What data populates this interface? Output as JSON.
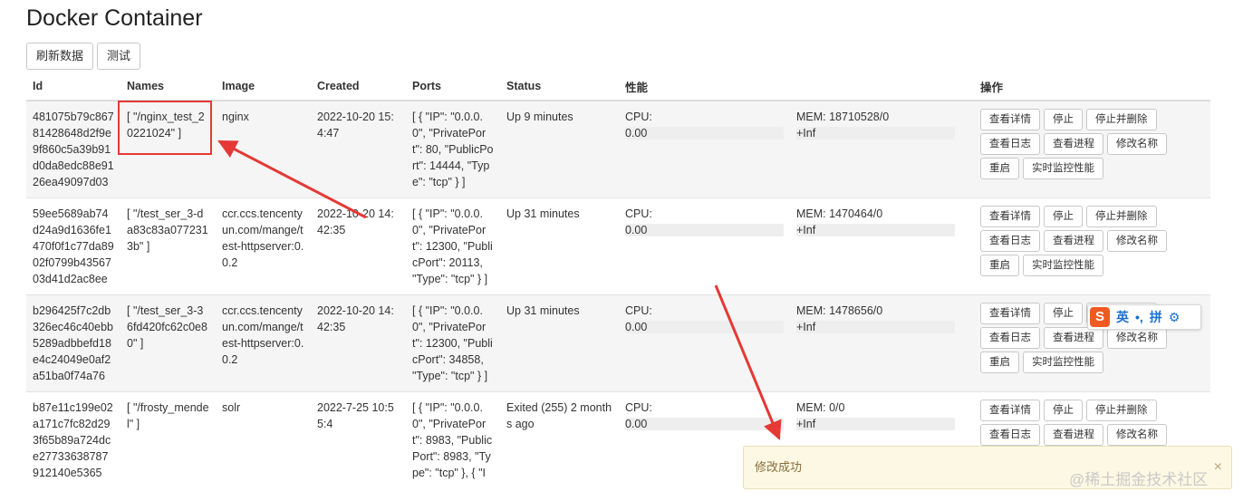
{
  "page": {
    "title": "Docker Container"
  },
  "toolbar": {
    "refresh_label": "刷新数据",
    "test_label": "测试"
  },
  "table": {
    "headers": {
      "id": "Id",
      "names": "Names",
      "image": "Image",
      "created": "Created",
      "ports": "Ports",
      "status": "Status",
      "perf": "性能",
      "ops": "操作"
    },
    "perf_labels": {
      "cpu": "CPU:",
      "mem_prefix": "MEM: "
    },
    "op_labels": {
      "detail": "查看详情",
      "stop": "停止",
      "stop_delete": "停止并删除",
      "logs": "查看日志",
      "process": "查看进程",
      "rename": "修改名称",
      "restart": "重启",
      "monitor": "实时监控性能"
    },
    "rows": [
      {
        "id": "481075b79c86781428648d2f9e9f860c5a39b91d0da8edc88e9126ea49097d03",
        "names": "[ \"/nginx_test_20221024\" ]",
        "image": "nginx",
        "created": "2022-10-20 15:4:47",
        "ports": "[ { \"IP\": \"0.0.0.0\", \"PrivatePort\": 80, \"PublicPort\": 14444, \"Type\": \"tcp\" } ]",
        "status": "Up 9 minutes",
        "cpu": "0.00",
        "mem": "18710528/0",
        "mem_limit": "+Inf"
      },
      {
        "id": "59ee5689ab74d24a9d1636fe1470f0f1c77da8902f0799b4356703d41d2ac8ee",
        "names": "[ \"/test_ser_3-da83c83a0772313b\" ]",
        "image": "ccr.ccs.tencentyun.com/mange/test-httpserver:0.0.2",
        "created": "2022-10-20 14:42:35",
        "ports": "[ { \"IP\": \"0.0.0.0\", \"PrivatePort\": 12300, \"PublicPort\": 20113, \"Type\": \"tcp\" } ]",
        "status": "Up 31 minutes",
        "cpu": "0.00",
        "mem": "1470464/0",
        "mem_limit": "+Inf"
      },
      {
        "id": "b296425f7c2db326ec46c40ebb5289adbbefd18e4c24049e0af2a51ba0f74a76",
        "names": "[ \"/test_ser_3-36fd420fc62c0e80\" ]",
        "image": "ccr.ccs.tencentyun.com/mange/test-httpserver:0.0.2",
        "created": "2022-10-20 14:42:35",
        "ports": "[ { \"IP\": \"0.0.0.0\", \"PrivatePort\": 12300, \"PublicPort\": 34858, \"Type\": \"tcp\" } ]",
        "status": "Up 31 minutes",
        "cpu": "0.00",
        "mem": "1478656/0",
        "mem_limit": "+Inf"
      },
      {
        "id": "b87e11c199e02a171c7fc82d293f65b89a724dce27733638787912140e5365",
        "names": "[ \"/frosty_mendel\" ]",
        "image": "solr",
        "created": "2022-7-25 10:55:4",
        "ports": "[ { \"IP\": \"0.0.0.0\", \"PrivatePort\": 8983, \"PublicPort\": 8983, \"Type\": \"tcp\" }, { \"I",
        "status": "Exited (255) 2 months ago",
        "cpu": "0.00",
        "mem": "0/0",
        "mem_limit": "+Inf"
      }
    ]
  },
  "ime": {
    "logo": "S",
    "mode": "英",
    "punct": "•,",
    "pinyin": "拼"
  },
  "toast": {
    "message": "修改成功",
    "close": "×"
  },
  "watermark": "@稀土掘金技术社区",
  "colors": {
    "annotation": "#e53935",
    "toast_bg": "#fcf8e3",
    "row_stripe": "#f5f5f5"
  }
}
